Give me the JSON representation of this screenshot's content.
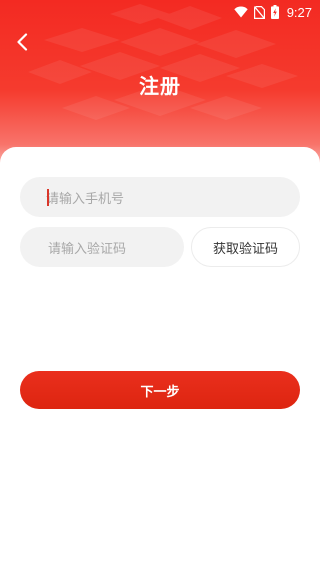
{
  "status_bar": {
    "time": "9:27",
    "icons": [
      "wifi-icon",
      "no-sim-icon",
      "battery-charging-icon"
    ]
  },
  "header": {
    "back_icon": "chevron-left-icon",
    "title": "注册"
  },
  "form": {
    "phone": {
      "value": "",
      "placeholder": "请输入手机号"
    },
    "code": {
      "value": "",
      "placeholder": "请输入验证码"
    },
    "get_code_label": "获取验证码",
    "next_label": "下一步"
  },
  "colors": {
    "brand_red": "#f32a22",
    "button_red": "#e02a15",
    "input_bg": "#f2f2f2",
    "placeholder_gray": "#a8a8a8",
    "caret_red": "#d9362a"
  }
}
